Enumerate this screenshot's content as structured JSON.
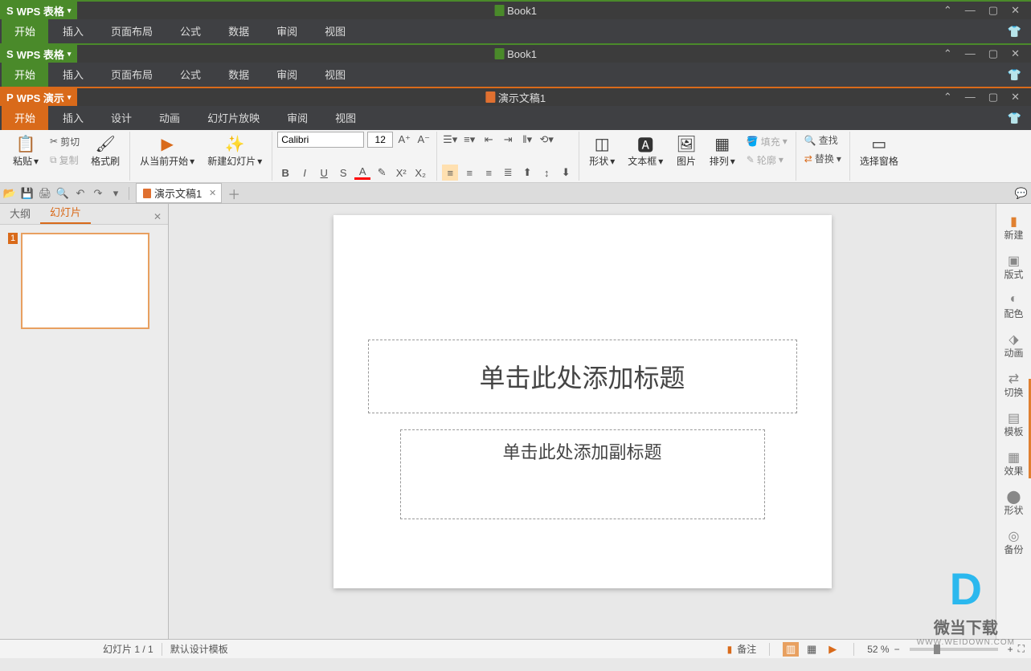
{
  "windows": [
    {
      "app_label": "WPS 表格",
      "doc_title": "Book1",
      "accent": "green"
    },
    {
      "app_label": "WPS 表格",
      "doc_title": "Book1",
      "accent": "green"
    },
    {
      "app_label": "WPS 演示",
      "doc_title": "演示文稿1",
      "accent": "orange"
    }
  ],
  "menus_spreadsheet": [
    "开始",
    "插入",
    "页面布局",
    "公式",
    "数据",
    "审阅",
    "视图"
  ],
  "menus_presentation": [
    "开始",
    "插入",
    "设计",
    "动画",
    "幻灯片放映",
    "审阅",
    "视图"
  ],
  "ribbon": {
    "paste": "粘贴",
    "cut": "剪切",
    "copy": "复制",
    "format_painter": "格式刷",
    "from_current": "从当前开始",
    "new_slide": "新建幻灯片",
    "font_name": "Calibri",
    "font_size": "12",
    "shape": "形状",
    "textbox": "文本框",
    "picture": "图片",
    "arrange": "排列",
    "fill": "填充",
    "outline": "轮廓",
    "find": "查找",
    "replace": "替换",
    "select_pane": "选择窗格"
  },
  "filetab": "演示文稿1",
  "left_tabs": {
    "outline": "大纲",
    "slides": "幻灯片"
  },
  "thumb_num": "1",
  "slide": {
    "title_placeholder": "单击此处添加标题",
    "subtitle_placeholder": "单击此处添加副标题"
  },
  "right_panel": [
    "新建",
    "版式",
    "配色",
    "动画",
    "切换",
    "模板",
    "效果",
    "形状",
    "备份"
  ],
  "statusbar": {
    "slide_pos": "幻灯片 1 / 1",
    "template": "默认设计模板",
    "notes": "备注",
    "zoom": "52 %"
  },
  "watermark": {
    "brand": "微当下载",
    "url": "WWW.WEIDOWN.COM"
  }
}
